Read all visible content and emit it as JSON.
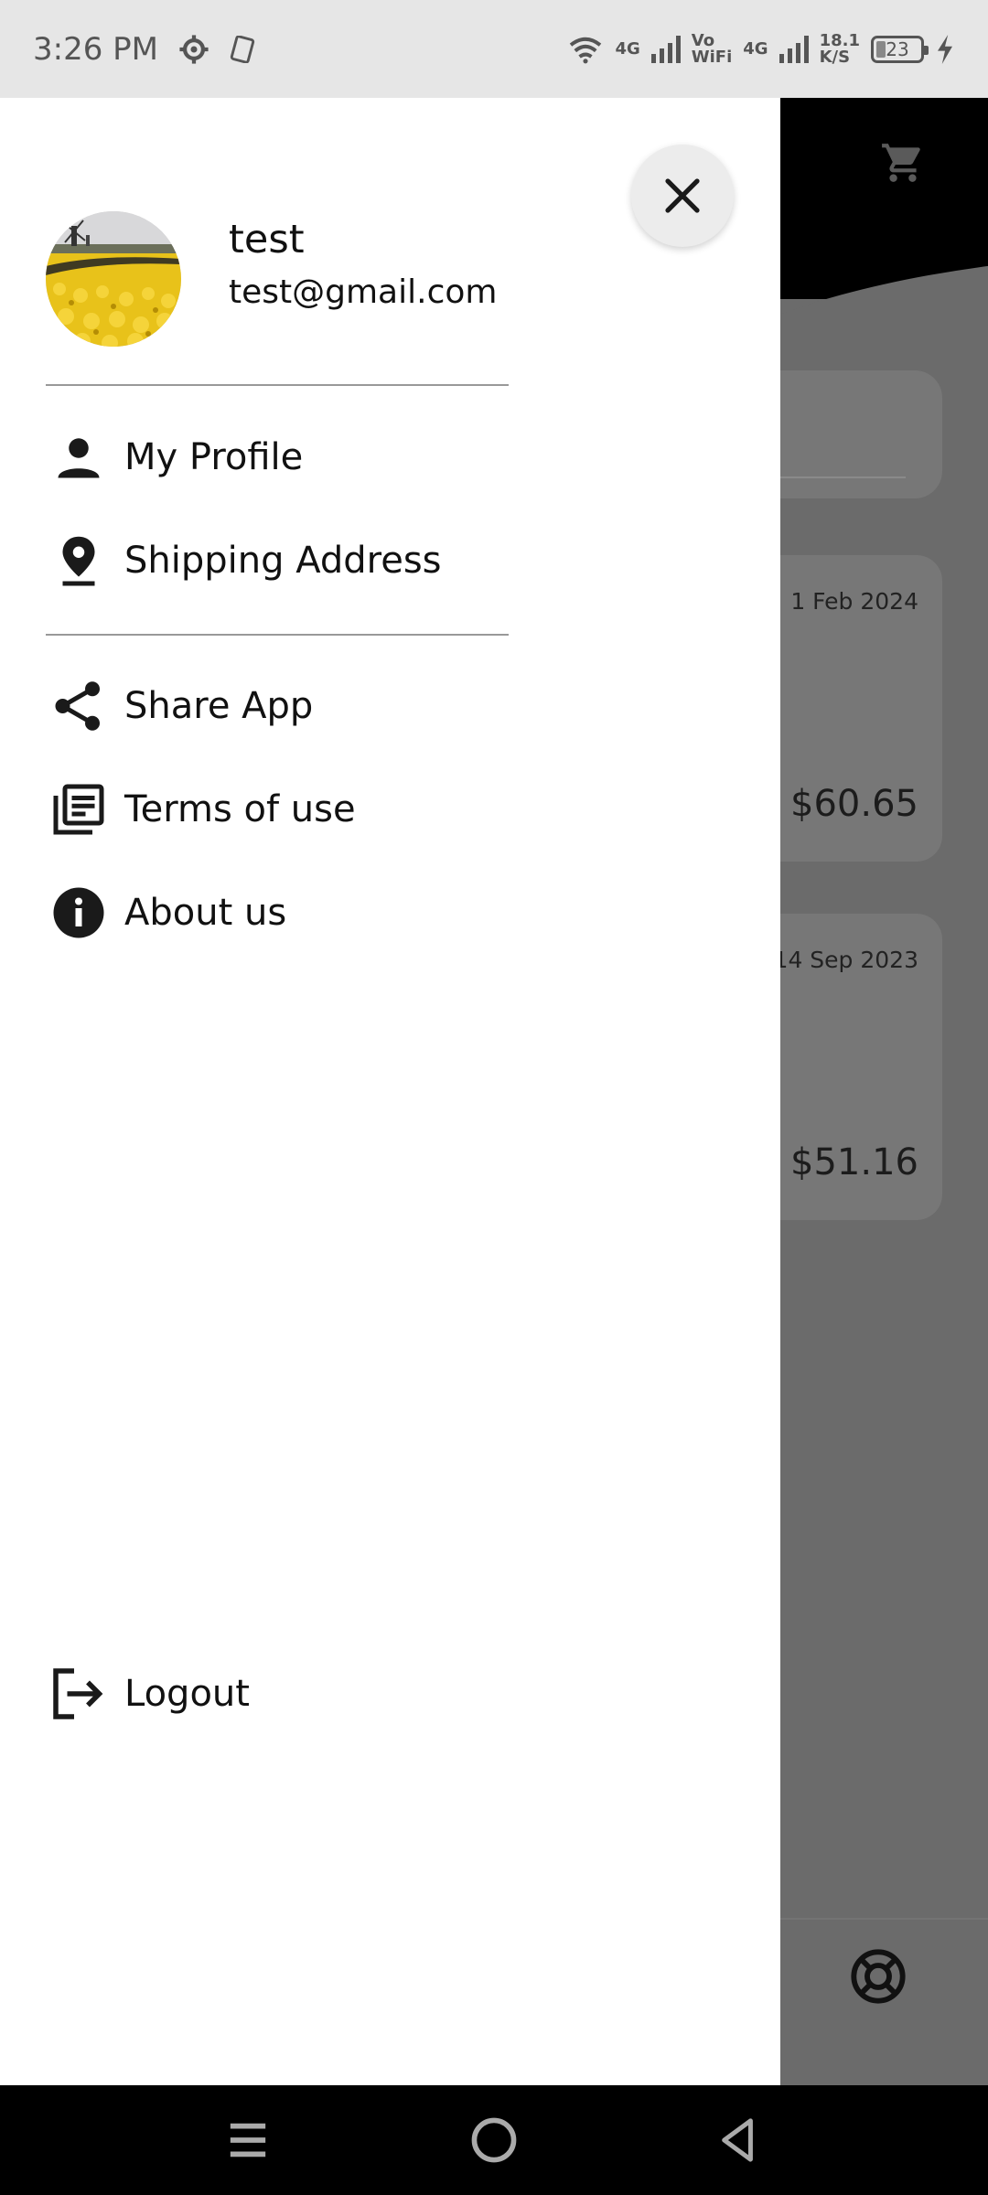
{
  "status_bar": {
    "time": "3:26 PM",
    "network_1": "4G",
    "vowifi_top": "Vo",
    "vowifi_bottom": "WiFi",
    "network_2": "4G",
    "speed_value": "18.1",
    "speed_unit": "K/S",
    "battery": "23"
  },
  "drawer": {
    "user": {
      "name": "test",
      "email": "test@gmail.com"
    },
    "menu_primary": [
      {
        "label": "My Profile",
        "icon": "person-icon"
      },
      {
        "label": "Shipping Address",
        "icon": "location-pin-icon"
      }
    ],
    "menu_secondary": [
      {
        "label": "Share App",
        "icon": "share-icon"
      },
      {
        "label": "Terms of use",
        "icon": "document-icon"
      },
      {
        "label": "About us",
        "icon": "info-icon"
      }
    ],
    "logout_label": "Logout"
  },
  "background": {
    "orders": [
      {
        "date": "1 Feb 2024",
        "price": "$60.65"
      },
      {
        "date": "14 Sep 2023",
        "price": "$51.16"
      }
    ]
  },
  "colors": {
    "drawer_bg": "#ffffff",
    "scrim": "#6b6b6b",
    "header": "#000000",
    "status_bar": "#e6e6e6",
    "avatar_flowers": "#e8c21a"
  }
}
